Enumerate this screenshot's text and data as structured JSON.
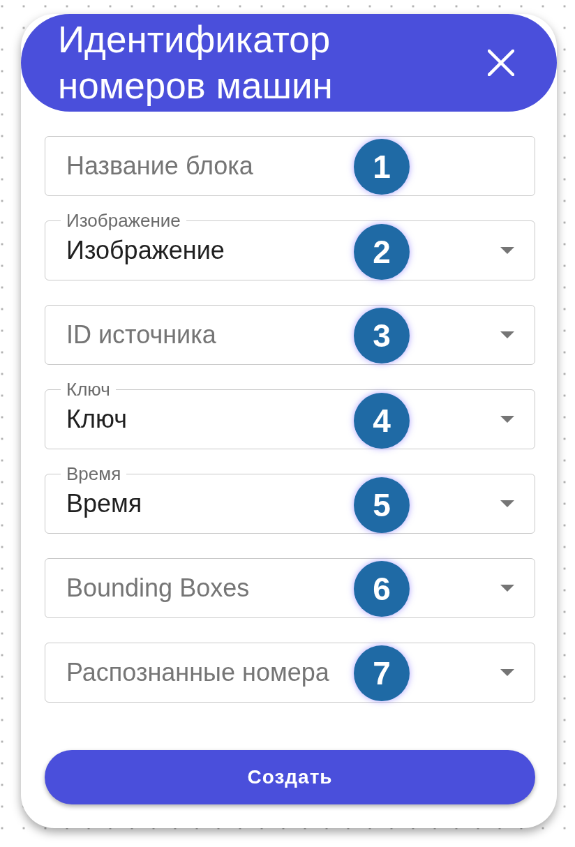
{
  "dialog": {
    "title": "Идентификатор номеров машин"
  },
  "fields": [
    {
      "kind": "text",
      "placeholder": "Название блока",
      "marker": "1"
    },
    {
      "kind": "select",
      "label": "Изображение",
      "value": "Изображение",
      "marker": "2"
    },
    {
      "kind": "select",
      "placeholder": "ID источника",
      "marker": "3"
    },
    {
      "kind": "select",
      "label": "Ключ",
      "value": "Ключ",
      "marker": "4"
    },
    {
      "kind": "select",
      "label": "Время",
      "value": "Время",
      "marker": "5"
    },
    {
      "kind": "select",
      "placeholder": "Bounding Boxes",
      "marker": "6"
    },
    {
      "kind": "select",
      "placeholder": "Распознанные номера",
      "marker": "7"
    }
  ],
  "submit_button": {
    "label": "Создать"
  }
}
